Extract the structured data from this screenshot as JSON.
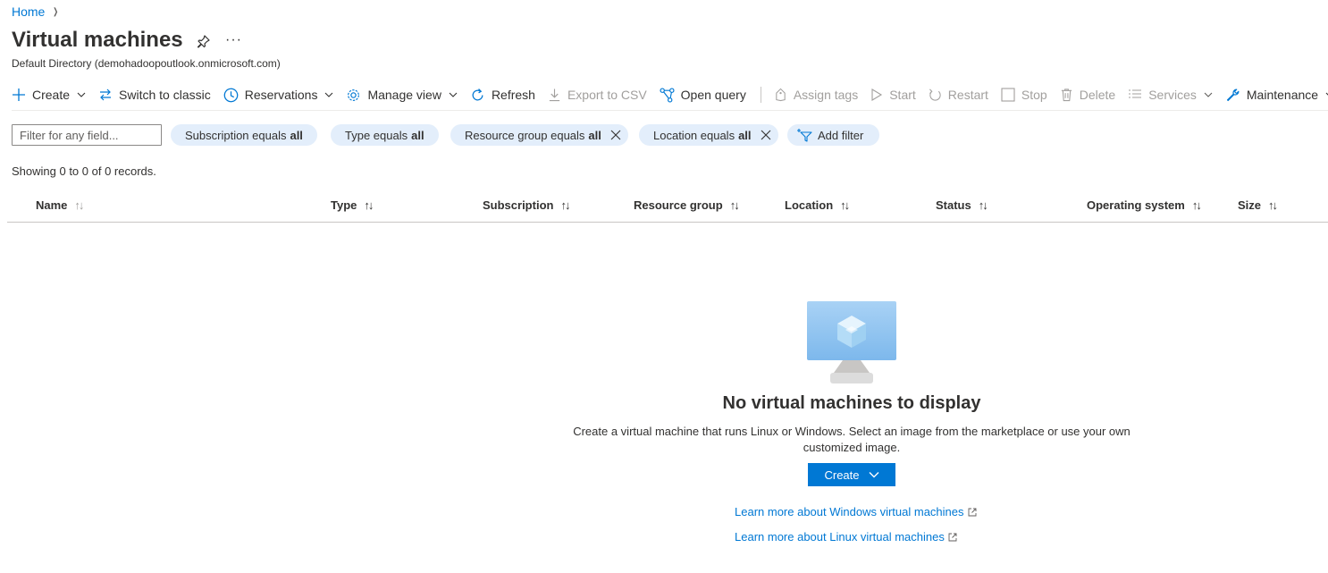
{
  "breadcrumb": {
    "home": "Home"
  },
  "header": {
    "title": "Virtual machines",
    "more": "···",
    "subtitle": "Default Directory (demohadoopoutlook.onmicrosoft.com)"
  },
  "toolbar": {
    "create": "Create",
    "switch_classic": "Switch to classic",
    "reservations": "Reservations",
    "manage_view": "Manage view",
    "refresh": "Refresh",
    "export_csv": "Export to CSV",
    "open_query": "Open query",
    "assign_tags": "Assign tags",
    "start": "Start",
    "restart": "Restart",
    "stop": "Stop",
    "delete": "Delete",
    "services": "Services",
    "maintenance": "Maintenance"
  },
  "filters": {
    "placeholder": "Filter for any field...",
    "subscription": {
      "label": "Subscription equals",
      "value": "all"
    },
    "type": {
      "label": "Type equals",
      "value": "all"
    },
    "resource_group": {
      "label": "Resource group equals",
      "value": "all"
    },
    "location": {
      "label": "Location equals",
      "value": "all"
    },
    "add_filter": "Add filter"
  },
  "records_text": "Showing 0 to 0 of 0 records.",
  "table": {
    "columns": [
      "Name",
      "Type",
      "Subscription",
      "Resource group",
      "Location",
      "Status",
      "Operating system",
      "Size"
    ],
    "sort_glyph": "↑↓"
  },
  "empty_state": {
    "title": "No virtual machines to display",
    "description": "Create a virtual machine that runs Linux or Windows. Select an image from the marketplace or use your own customized image.",
    "create_button": "Create",
    "learn_windows": "Learn more about Windows virtual machines",
    "learn_linux": "Learn more about Linux virtual machines"
  },
  "colors": {
    "accent": "#0078d4",
    "pill_bg": "#e3eefb",
    "disabled_text": "#a19f9d"
  }
}
